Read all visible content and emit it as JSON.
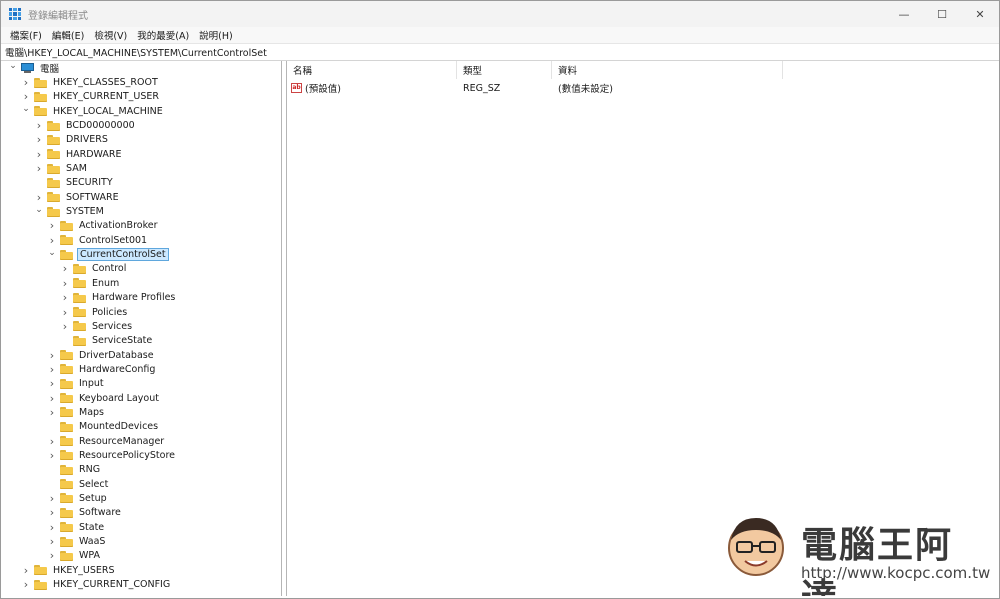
{
  "window": {
    "title": "登錄編輯程式",
    "controls": {
      "minimize": "—",
      "maximize": "☐",
      "close": "✕"
    }
  },
  "menu": [
    "檔案(F)",
    "編輯(E)",
    "檢視(V)",
    "我的最愛(A)",
    "說明(H)"
  ],
  "address": "電腦\\HKEY_LOCAL_MACHINE\\SYSTEM\\CurrentControlSet",
  "tree": [
    {
      "label": "電腦",
      "depth": 0,
      "expander": "expanded",
      "icon": "computer-icon"
    },
    {
      "label": "HKEY_CLASSES_ROOT",
      "depth": 1,
      "expander": "collapsed",
      "icon": "folder-icon"
    },
    {
      "label": "HKEY_CURRENT_USER",
      "depth": 1,
      "expander": "collapsed",
      "icon": "folder-icon"
    },
    {
      "label": "HKEY_LOCAL_MACHINE",
      "depth": 1,
      "expander": "expanded",
      "icon": "folder-icon"
    },
    {
      "label": "BCD00000000",
      "depth": 2,
      "expander": "collapsed",
      "icon": "folder-icon"
    },
    {
      "label": "DRIVERS",
      "depth": 2,
      "expander": "collapsed",
      "icon": "folder-icon"
    },
    {
      "label": "HARDWARE",
      "depth": 2,
      "expander": "collapsed",
      "icon": "folder-icon"
    },
    {
      "label": "SAM",
      "depth": 2,
      "expander": "collapsed",
      "icon": "folder-icon"
    },
    {
      "label": "SECURITY",
      "depth": 2,
      "expander": "none",
      "icon": "folder-icon"
    },
    {
      "label": "SOFTWARE",
      "depth": 2,
      "expander": "collapsed",
      "icon": "folder-icon"
    },
    {
      "label": "SYSTEM",
      "depth": 2,
      "expander": "expanded",
      "icon": "folder-icon"
    },
    {
      "label": "ActivationBroker",
      "depth": 3,
      "expander": "collapsed",
      "icon": "folder-icon"
    },
    {
      "label": "ControlSet001",
      "depth": 3,
      "expander": "collapsed",
      "icon": "folder-icon"
    },
    {
      "label": "CurrentControlSet",
      "depth": 3,
      "expander": "expanded",
      "icon": "folder-icon",
      "selected": true
    },
    {
      "label": "Control",
      "depth": 4,
      "expander": "collapsed",
      "icon": "folder-icon"
    },
    {
      "label": "Enum",
      "depth": 4,
      "expander": "collapsed",
      "icon": "folder-icon"
    },
    {
      "label": "Hardware Profiles",
      "depth": 4,
      "expander": "collapsed",
      "icon": "folder-icon"
    },
    {
      "label": "Policies",
      "depth": 4,
      "expander": "collapsed",
      "icon": "folder-icon"
    },
    {
      "label": "Services",
      "depth": 4,
      "expander": "collapsed",
      "icon": "folder-icon"
    },
    {
      "label": "ServiceState",
      "depth": 4,
      "expander": "none",
      "icon": "folder-icon"
    },
    {
      "label": "DriverDatabase",
      "depth": 3,
      "expander": "collapsed",
      "icon": "folder-icon"
    },
    {
      "label": "HardwareConfig",
      "depth": 3,
      "expander": "collapsed",
      "icon": "folder-icon"
    },
    {
      "label": "Input",
      "depth": 3,
      "expander": "collapsed",
      "icon": "folder-icon"
    },
    {
      "label": "Keyboard Layout",
      "depth": 3,
      "expander": "collapsed",
      "icon": "folder-icon"
    },
    {
      "label": "Maps",
      "depth": 3,
      "expander": "collapsed",
      "icon": "folder-icon"
    },
    {
      "label": "MountedDevices",
      "depth": 3,
      "expander": "none",
      "icon": "folder-icon"
    },
    {
      "label": "ResourceManager",
      "depth": 3,
      "expander": "collapsed",
      "icon": "folder-icon"
    },
    {
      "label": "ResourcePolicyStore",
      "depth": 3,
      "expander": "collapsed",
      "icon": "folder-icon"
    },
    {
      "label": "RNG",
      "depth": 3,
      "expander": "none",
      "icon": "folder-icon"
    },
    {
      "label": "Select",
      "depth": 3,
      "expander": "none",
      "icon": "folder-icon"
    },
    {
      "label": "Setup",
      "depth": 3,
      "expander": "collapsed",
      "icon": "folder-icon"
    },
    {
      "label": "Software",
      "depth": 3,
      "expander": "collapsed",
      "icon": "folder-icon"
    },
    {
      "label": "State",
      "depth": 3,
      "expander": "collapsed",
      "icon": "folder-icon"
    },
    {
      "label": "WaaS",
      "depth": 3,
      "expander": "collapsed",
      "icon": "folder-icon"
    },
    {
      "label": "WPA",
      "depth": 3,
      "expander": "collapsed",
      "icon": "folder-icon"
    },
    {
      "label": "HKEY_USERS",
      "depth": 1,
      "expander": "collapsed",
      "icon": "folder-icon"
    },
    {
      "label": "HKEY_CURRENT_CONFIG",
      "depth": 1,
      "expander": "collapsed",
      "icon": "folder-icon"
    }
  ],
  "list": {
    "columns": [
      "名稱",
      "類型",
      "資料"
    ],
    "rows": [
      {
        "icon": "string-value-icon",
        "icon_text": "ab",
        "name": "(預設值)",
        "type": "REG_SZ",
        "data": "(數值未設定)"
      }
    ]
  },
  "watermark": {
    "title": "電腦王阿達",
    "url": "http://www.kocpc.com.tw"
  }
}
